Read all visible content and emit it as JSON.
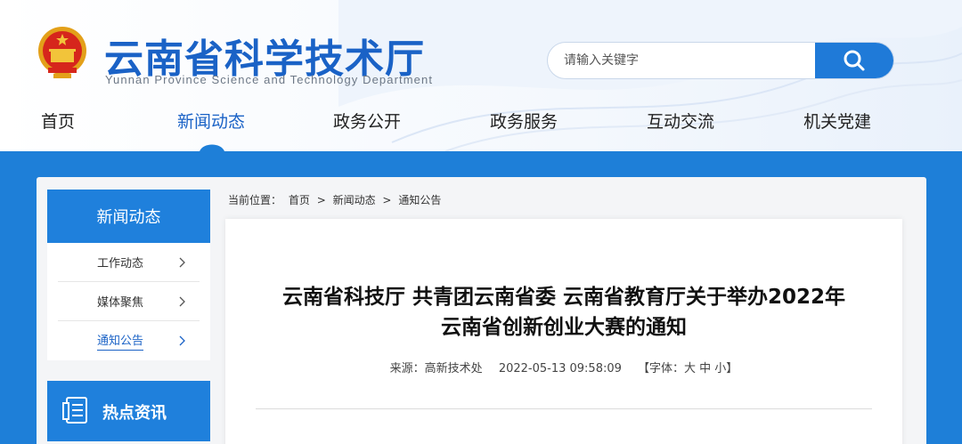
{
  "header": {
    "brand_cn": "云南省科学技术厅",
    "brand_en": "Yunnan Province Science and Technology Department",
    "search": {
      "placeholder": "请输入关键字"
    }
  },
  "nav": {
    "items": [
      "首页",
      "新闻动态",
      "政务公开",
      "政务服务",
      "互动交流",
      "机关党建"
    ],
    "active_index": 1
  },
  "sidebar": {
    "title": "新闻动态",
    "items": [
      {
        "label": "工作动态"
      },
      {
        "label": "媒体聚焦"
      },
      {
        "label": "通知公告",
        "active": true
      }
    ],
    "hot_title": "热点资讯"
  },
  "breadcrumb": {
    "prefix": "当前位置：",
    "items": [
      "首页",
      ">",
      "新闻动态",
      ">",
      "通知公告"
    ]
  },
  "article": {
    "title_line1": "云南省科技厅 共青团云南省委 云南省教育厅关于举办2022年",
    "title_line2": "云南省创新创业大赛的通知",
    "source": "来源：高新技术处",
    "datetime": "2022-05-13 09:58:09",
    "font_size": "【字体：大 中 小】"
  },
  "colors": {
    "brand": "#1a62c6",
    "accent": "#1f80dc",
    "bg_blue": "#1e7fd8"
  }
}
